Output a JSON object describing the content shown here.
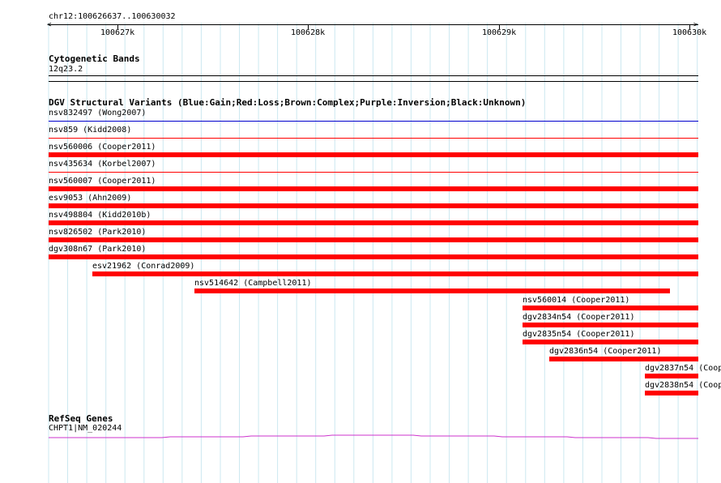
{
  "ruler": {
    "region": "chr12:100626637..100630032",
    "ticks": [
      "100627k",
      "100628k",
      "100629k",
      "100630k"
    ]
  },
  "cytobands": {
    "title": "Cytogenetic Bands",
    "band": "12q23.2"
  },
  "dgv": {
    "title": "DGV Structural Variants (Blue:Gain;Red:Loss;Brown:Complex;Purple:Inversion;Black:Unknown)",
    "colors": {
      "gain": "#0000cc",
      "loss": "#ff0000"
    },
    "items": [
      {
        "label": "nsv832497 (Wong2007)"
      },
      {
        "label": "nsv859 (Kidd2008)"
      },
      {
        "label": "nsv560006 (Cooper2011)"
      },
      {
        "label": "nsv435634 (Korbel2007)"
      },
      {
        "label": "nsv560007 (Cooper2011)"
      },
      {
        "label": "esv9053 (Ahn2009)"
      },
      {
        "label": "nsv498804 (Kidd2010b)"
      },
      {
        "label": "nsv826502 (Park2010)"
      },
      {
        "label": "dgv308n67 (Park2010)"
      },
      {
        "label": "esv21962 (Conrad2009)"
      },
      {
        "label": "nsv514642 (Campbell2011)"
      },
      {
        "label": "nsv560014 (Cooper2011)"
      },
      {
        "label": "dgv2834n54 (Cooper2011)"
      },
      {
        "label": "dgv2835n54 (Cooper2011)"
      },
      {
        "label": "dgv2836n54 (Cooper2011)"
      },
      {
        "label": "dgv2837n54 (Coop"
      },
      {
        "label": "dgv2838n54 (Coop"
      }
    ]
  },
  "refseq": {
    "title": "RefSeq Genes",
    "gene": "CHPT1|NM_020244",
    "color": "#cc33cc"
  }
}
